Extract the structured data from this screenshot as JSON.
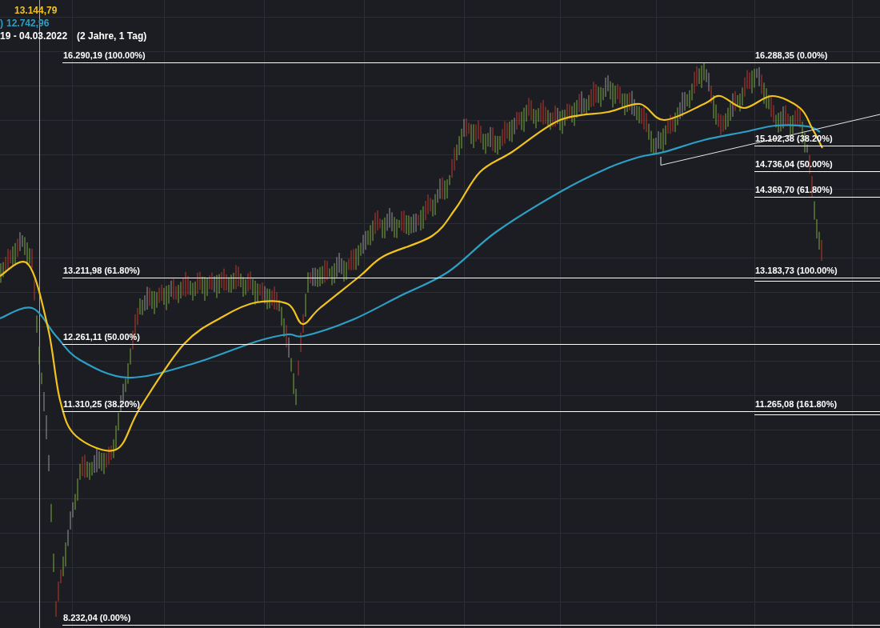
{
  "legend": [
    {
      "value": "13.144,79",
      "color": "#f2c31c"
    },
    {
      "prefix": ")",
      "value": "12.742,96",
      "color": "#2d9fc4"
    }
  ],
  "range": {
    "dates": "19 - 04.03.2022",
    "duration": "(2 Jahre, 1 Tag)"
  },
  "fibonacci_left": [
    "16.290,19 (100.00%)",
    "13.211,98 (61.80%)",
    "12.261,11 (50.00%)",
    "11.310,25 (38.20%)",
    "8.232,04 (0.00%)"
  ],
  "fibonacci_right": [
    "16.288,35 (0.00%)",
    "15.102,38 (38.20%)",
    "14.736,04 (50.00%)",
    "14.369,70 (61.80%)",
    "13.183,73 (100.00%)",
    "11.265,08 (161.80%)"
  ]
}
